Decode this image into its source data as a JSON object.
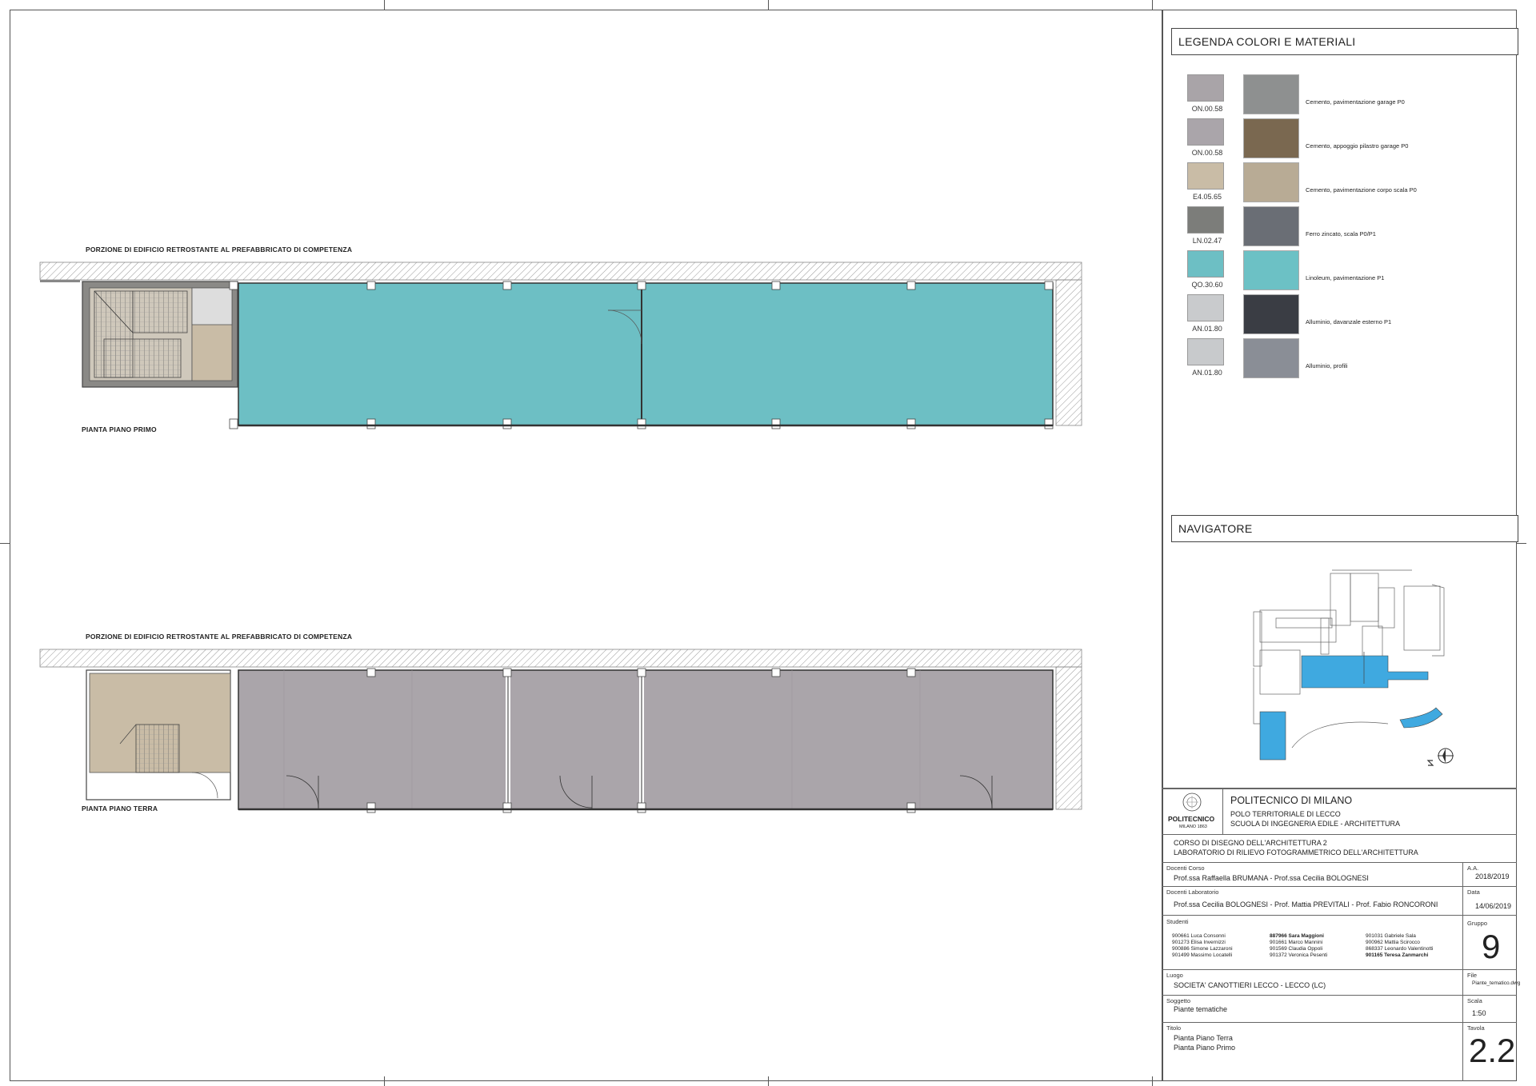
{
  "plans": {
    "upper_caption": "PORZIONE DI EDIFICIO RETROSTANTE AL PREFABBRICATO DI COMPETENZA",
    "upper_plan_name": "PIANTA PIANO PRIMO",
    "lower_caption": "PORZIONE DI EDIFICIO RETROSTANTE AL PREFABBRICATO DI COMPETENZA",
    "lower_plan_name": "PIANTA PIANO TERRA"
  },
  "legend": {
    "title": "LEGENDA COLORI E MATERIALI",
    "items": [
      {
        "code": "ON.00.58",
        "color": "#a9a4a8",
        "photo_color": "#8e9090",
        "description": "Cemento, pavimentazione garage P0"
      },
      {
        "code": "ON.00.58",
        "color": "#aaa5aa",
        "photo_color": "#7a6850",
        "description": "Cemento, appoggio pilastro garage P0"
      },
      {
        "code": "E4.05.65",
        "color": "#c9bca6",
        "photo_color": "#b8ab95",
        "description": "Cemento, pavimentazione corpo scala P0"
      },
      {
        "code": "LN.02.47",
        "color": "#7c7d7a",
        "photo_color": "#6a6e75",
        "description": "Ferro zincato, scala P0/P1"
      },
      {
        "code": "QO.30.60",
        "color": "#6dbfc4",
        "photo_color": "#6cc1c5",
        "description": "Linoleum, pavimentazione P1"
      },
      {
        "code": "AN.01.80",
        "color": "#c9cbcd",
        "photo_color": "#3a3d44",
        "description": "Alluminio, davanzale esterno P1"
      },
      {
        "code": "AN.01.80",
        "color": "#c8cacc",
        "photo_color": "#8a8e96",
        "description": "Alluminio, profili"
      }
    ]
  },
  "navigator": {
    "title": "NAVIGATORE"
  },
  "title_block": {
    "institution": "POLITECNICO DI MILANO",
    "campus": "POLO TERRITORIALE DI LECCO",
    "school": "SCUOLA DI INGEGNERIA EDILE - ARCHITETTURA",
    "logo_text": "POLITECNICO",
    "logo_sub": "MILANO 1863",
    "course_line1": "CORSO DI DISEGNO DELL'ARCHITETTURA 2",
    "course_line2": "LABORATORIO DI RILIEVO FOTOGRAMMETRICO DELL'ARCHITETTURA",
    "docenti_corso_label": "Docenti Corso",
    "docenti_corso": "Prof.ssa Raffaella BRUMANA - Prof.ssa Cecilia BOLOGNESI",
    "aa_label": "A.A.",
    "aa": "2018/2019",
    "docenti_lab_label": "Docenti Laboratorio",
    "docenti_lab": "Prof.ssa Cecilia BOLOGNESI - Prof. Mattia PREVITALI - Prof. Fabio RONCORONI",
    "data_label": "Data",
    "data": "14/06/2019",
    "studenti_label": "Studenti",
    "students_col1": [
      "900661  Luca Consonni",
      "901273  Elisa Invernizzi",
      "900886  Simone Lazzaroni",
      "901499  Massimo Locatelli"
    ],
    "students_col2": [
      "887966  Sara Maggioni",
      "901661  Marco Mannini",
      "901569  Claudia Oppoli",
      "901372  Veronica Pesenti"
    ],
    "students_col3": [
      "901031  Gabriele Sala",
      "900962  Mattia Scirocco",
      "868337  Leonardo Valentinotti",
      "901165  Teresa Zanmarchi"
    ],
    "gruppo_label": "Gruppo",
    "gruppo": "9",
    "luogo_label": "Luogo",
    "luogo": "SOCIETA' CANOTTIERI LECCO - LECCO (LC)",
    "file_label": "File",
    "file": "Piante_tematico.dwg",
    "soggetto_label": "Soggetto",
    "soggetto": "Piante tematiche",
    "scala_label": "Scala",
    "scala": "1:50",
    "titolo_label": "Titolo",
    "titolo_line1": "Pianta Piano Terra",
    "titolo_line2": "Pianta Piano Primo",
    "tavola_label": "Tavola",
    "tavola": "2.2"
  }
}
